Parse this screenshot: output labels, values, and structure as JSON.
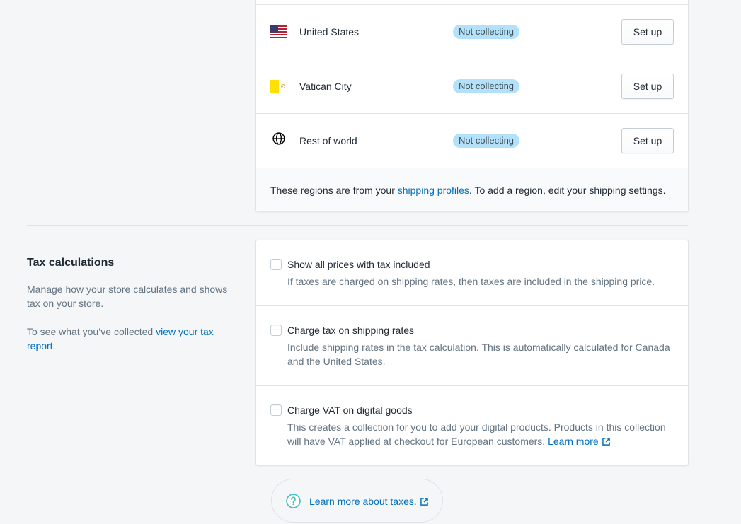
{
  "regions": [
    {
      "name": "United States",
      "status": "Not collecting",
      "action": "Set up",
      "flag_icon": "us-flag-icon"
    },
    {
      "name": "Vatican City",
      "status": "Not collecting",
      "action": "Set up",
      "flag_icon": "vatican-flag-icon"
    },
    {
      "name": "Rest of world",
      "status": "Not collecting",
      "action": "Set up",
      "flag_icon": "globe-icon"
    }
  ],
  "regions_footer": {
    "prefix": "These regions are from your ",
    "link": "shipping profiles",
    "suffix": ". To add a region, edit your shipping settings."
  },
  "tax_section": {
    "title": "Tax calculations",
    "description": "Manage how your store calculates and shows tax on your store.",
    "report_prefix": "To see what you’ve collected ",
    "report_link": "view your tax report",
    "report_suffix": "."
  },
  "options": [
    {
      "label": "Show all prices with tax included",
      "help": "If taxes are charged on shipping rates, then taxes are included in the shipping price.",
      "checked": false
    },
    {
      "label": "Charge tax on shipping rates",
      "help": "Include shipping rates in the tax calculation. This is automatically calculated for Canada and the United States.",
      "checked": false
    },
    {
      "label": "Charge VAT on digital goods",
      "help": "This creates a collection for you to add your digital products. Products in this collection will have VAT applied at checkout for European customers. ",
      "help_link": "Learn more",
      "checked": false
    }
  ],
  "footer_help": {
    "link": "Learn more about taxes.",
    "icon": "question-circle-icon"
  },
  "colors": {
    "link": "#006fbb",
    "badge_bg": "#b4e1fa",
    "page_bg": "#f4f6f8",
    "help_icon": "#47c1bf"
  }
}
